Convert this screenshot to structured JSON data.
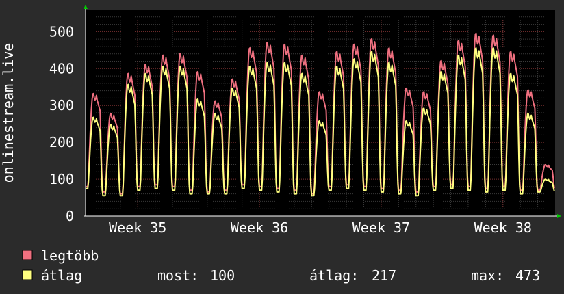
{
  "chart_data": {
    "type": "line",
    "ylabel": "onlinestream.live",
    "ylim": [
      0,
      560
    ],
    "yticks": [
      0,
      100,
      200,
      300,
      400,
      500
    ],
    "x_ticks": [
      "Week 35",
      "Week 36",
      "Week 37",
      "Week 38"
    ],
    "grid": true,
    "background": "#000000",
    "series": [
      {
        "name": "legtöbb",
        "color": "#f07080",
        "daily_peaks": [
          335,
          280,
          390,
          415,
          440,
          445,
          395,
          315,
          375,
          460,
          475,
          470,
          440,
          340,
          450,
          470,
          485,
          460,
          350,
          340,
          425,
          480,
          500,
          495,
          450,
          345,
          140
        ],
        "daily_lows": [
          80,
          65,
          60,
          80,
          85,
          80,
          70,
          65,
          70,
          85,
          80,
          75,
          70,
          60,
          80,
          85,
          80,
          75,
          70,
          65,
          80,
          85,
          80,
          75,
          80,
          70,
          70
        ]
      },
      {
        "name": "átlag",
        "color": "#ffff80",
        "daily_peaks": [
          270,
          250,
          360,
          390,
          410,
          410,
          320,
          280,
          350,
          410,
          420,
          420,
          390,
          260,
          410,
          430,
          450,
          420,
          260,
          295,
          395,
          440,
          460,
          460,
          390,
          280,
          100
        ],
        "daily_lows": [
          75,
          55,
          55,
          70,
          75,
          70,
          60,
          60,
          60,
          75,
          70,
          65,
          60,
          55,
          70,
          75,
          70,
          65,
          60,
          55,
          70,
          75,
          70,
          65,
          70,
          60,
          65
        ]
      }
    ],
    "legend": {
      "placement": "bottom-left",
      "items": [
        "legtöbb",
        "átlag"
      ],
      "stats": [
        {
          "label": "most:",
          "value": "100"
        },
        {
          "label": "átlag:",
          "value": "217"
        },
        {
          "label": "max:",
          "value": "473"
        }
      ]
    }
  }
}
